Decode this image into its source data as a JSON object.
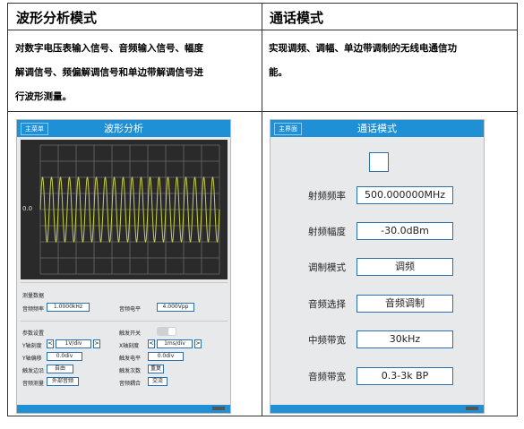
{
  "headers": {
    "waveform_mode": "波形分析模式",
    "call_mode": "通话模式"
  },
  "descriptions": {
    "waveform_lines": [
      "对数字电压表输入信号、音频输入信号、幅度",
      "解调信号、频偏解调信号和单边带解调信号进",
      "行波形测量。"
    ],
    "call_lines": [
      "实现调频、调幅、单边带调制的无线电通信功",
      "能。"
    ]
  },
  "waveform_panel": {
    "menu_button": "主菜单",
    "title": "波形分析",
    "axis_zero": "0.0",
    "measure_section": "测量数据",
    "audio_freq_label": "音频频率",
    "audio_freq_value": "1.0000kHz",
    "audio_level_label": "音频电平",
    "audio_level_value": "4.000Vpp",
    "params_section": "参数设置",
    "trigger_switch_label": "触发开关",
    "trigger_switch_on": true,
    "y_scale_label": "Y轴刻度",
    "y_scale_value": "1V/div",
    "x_scale_label": "X轴刻度",
    "x_scale_value": "1ms/div",
    "y_offset_label": "Y轴偏移",
    "y_offset_value": "0.0div",
    "trigger_level_label": "触发电平",
    "trigger_level_value": "0.0div",
    "trigger_edge_label": "触发边沿",
    "trigger_edge_value": "自由",
    "trigger_count_label": "触发次数",
    "trigger_count_value": "重复",
    "audio_measure_label": "音频测量",
    "audio_measure_value": "外部音频",
    "audio_coupling_label": "音频耦合",
    "audio_coupling_value": "交流",
    "arrow_left": "<",
    "arrow_right": ">",
    "wave_cycles": 20,
    "wave_amplitude_div": 2
  },
  "call_panel": {
    "menu_button": "主界面",
    "title": "通话模式",
    "rf_freq_label": "射频频率",
    "rf_freq_value": "500.000000MHz",
    "rf_amp_label": "射频幅度",
    "rf_amp_value": "-30.0dBm",
    "mod_mode_label": "调制模式",
    "mod_mode_value": "调频",
    "audio_select_label": "音频选择",
    "audio_select_value": "音频调制",
    "if_bw_label": "中频带宽",
    "if_bw_value": "30kHz",
    "audio_bw_label": "音频带宽",
    "audio_bw_value": "0.3-3k BP"
  },
  "colors": {
    "bar": "#1f8fd6",
    "wave": "#c9cf4a",
    "grid": "#6a6a6a",
    "scope_bg": "#2a2a2a"
  }
}
